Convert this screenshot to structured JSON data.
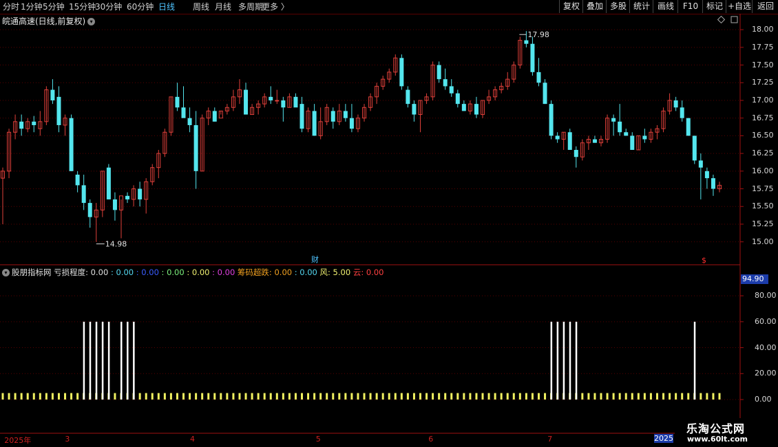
{
  "toolbar": {
    "tabs": [
      "分时",
      "1分钟",
      "5分钟",
      "15分钟",
      "30分钟",
      "60分钟",
      "日线",
      "周线",
      "月线",
      "多周期",
      "更多 〉"
    ],
    "active_tab": "日线",
    "right_buttons": [
      "复权",
      "叠加",
      "多股",
      "统计",
      "画线",
      "F10",
      "标记",
      "+自选",
      "返回"
    ]
  },
  "chart_title": "皖通高速(日线,前复权)",
  "chart_title_icon": "chevron-down-icon",
  "price_axis": {
    "ticks": [
      "18.00",
      "17.75",
      "17.50",
      "17.25",
      "17.00",
      "16.75",
      "16.50",
      "16.25",
      "16.00",
      "15.75",
      "15.50",
      "15.25",
      "15.00"
    ]
  },
  "markers": {
    "high": "17.98",
    "low": "14.98",
    "finance": "财",
    "dividend": "$"
  },
  "indicator": {
    "name": "股朋指标网",
    "items": [
      {
        "label": "亏损程度: 0.00",
        "color": "#e0e0e0"
      },
      {
        "label": ": 0.00",
        "color": "#54d7f0"
      },
      {
        "label": ": 0.00",
        "color": "#3a5cff"
      },
      {
        "label": ": 0.00",
        "color": "#7cf07c"
      },
      {
        "label": ": 0.00",
        "color": "#f0f070"
      },
      {
        "label": ": 0.00",
        "color": "#e040e0"
      },
      {
        "label": "筹码超跌: 0.00",
        "color": "#f0a020"
      },
      {
        "label": ": 0.00",
        "color": "#54d7f0"
      },
      {
        "label": "风: 5.00",
        "color": "#f0f070"
      },
      {
        "label": "云: 0.00",
        "color": "#ff4040"
      }
    ],
    "badge": "94.90",
    "ticks": [
      "80.00",
      "60.00",
      "40.00",
      "20.00",
      "0.00"
    ]
  },
  "x_axis": {
    "labels": [
      {
        "text": "2025年",
        "pos": 0.003
      },
      {
        "text": "3",
        "pos": 0.085
      },
      {
        "text": "4",
        "pos": 0.254
      },
      {
        "text": "5",
        "pos": 0.424
      },
      {
        "text": "6",
        "pos": 0.576
      },
      {
        "text": "7",
        "pos": 0.737
      }
    ],
    "year_badge": "2025"
  },
  "watermark": {
    "line1": "乐淘公式网",
    "line2": "www.60lt.com"
  },
  "colors": {
    "up": "#e0403a",
    "down": "#54e6ee",
    "grid": "#5a0000",
    "axis": "#a01010"
  },
  "chart_data": {
    "type": "candlestick",
    "ylim": [
      14.88,
      18.05
    ],
    "candles": [
      [
        15.9,
        16.05,
        15.25,
        16.0
      ],
      [
        16.0,
        16.6,
        15.9,
        16.55
      ],
      [
        16.55,
        16.8,
        16.45,
        16.7
      ],
      [
        16.7,
        16.8,
        16.5,
        16.6
      ],
      [
        16.6,
        16.75,
        16.55,
        16.7
      ],
      [
        16.7,
        16.78,
        16.55,
        16.65
      ],
      [
        16.6,
        16.85,
        16.5,
        16.7
      ],
      [
        16.7,
        17.2,
        16.65,
        17.15
      ],
      [
        17.15,
        17.3,
        16.95,
        17.0
      ],
      [
        17.05,
        17.2,
        16.55,
        16.65
      ],
      [
        16.65,
        16.8,
        16.5,
        16.75
      ],
      [
        16.75,
        16.8,
        16.0,
        16.0
      ],
      [
        15.95,
        16.0,
        15.7,
        15.8
      ],
      [
        15.8,
        15.95,
        15.45,
        15.55
      ],
      [
        15.55,
        15.6,
        15.2,
        15.35
      ],
      [
        15.35,
        15.55,
        15.0,
        15.45
      ],
      [
        15.45,
        16.0,
        15.35,
        16.0
      ],
      [
        16.05,
        16.1,
        15.6,
        15.6
      ],
      [
        15.6,
        15.7,
        15.3,
        15.45
      ],
      [
        15.45,
        15.6,
        15.05,
        15.65
      ],
      [
        15.65,
        15.7,
        15.55,
        15.6
      ],
      [
        15.6,
        15.8,
        15.5,
        15.75
      ],
      [
        15.75,
        15.85,
        15.5,
        15.6
      ],
      [
        15.6,
        15.9,
        15.4,
        15.85
      ],
      [
        15.85,
        16.1,
        15.8,
        16.05
      ],
      [
        16.05,
        16.3,
        15.9,
        16.25
      ],
      [
        16.25,
        16.6,
        16.2,
        16.55
      ],
      [
        16.55,
        17.05,
        16.5,
        17.05
      ],
      [
        17.05,
        17.25,
        16.85,
        16.9
      ],
      [
        16.9,
        17.2,
        16.85,
        16.75
      ],
      [
        16.75,
        16.9,
        16.55,
        16.65
      ],
      [
        16.65,
        16.85,
        15.75,
        16.0
      ],
      [
        16.0,
        16.8,
        16.0,
        16.75
      ],
      [
        16.75,
        16.9,
        16.65,
        16.85
      ],
      [
        16.85,
        16.9,
        16.7,
        16.7
      ],
      [
        16.75,
        16.85,
        16.8,
        16.85
      ],
      [
        16.85,
        16.95,
        16.8,
        16.9
      ],
      [
        16.9,
        17.15,
        16.85,
        17.05
      ],
      [
        17.05,
        17.3,
        16.95,
        17.15
      ],
      [
        17.15,
        17.25,
        16.8,
        16.8
      ],
      [
        16.8,
        16.95,
        16.8,
        16.9
      ],
      [
        16.9,
        17.0,
        16.8,
        16.95
      ],
      [
        16.95,
        17.1,
        16.9,
        17.05
      ],
      [
        17.05,
        17.2,
        16.95,
        17.0
      ],
      [
        17.0,
        17.15,
        16.95,
        17.0
      ],
      [
        17.0,
        17.05,
        16.7,
        16.9
      ],
      [
        16.9,
        17.1,
        16.9,
        17.05
      ],
      [
        17.05,
        17.1,
        16.95,
        16.9
      ],
      [
        16.95,
        17.05,
        16.55,
        16.6
      ],
      [
        16.6,
        16.9,
        16.55,
        16.85
      ],
      [
        16.85,
        16.95,
        16.5,
        16.5
      ],
      [
        16.5,
        16.9,
        16.45,
        16.7
      ],
      [
        16.7,
        16.95,
        16.65,
        16.9
      ],
      [
        16.85,
        16.9,
        16.6,
        16.7
      ],
      [
        16.7,
        16.95,
        16.65,
        16.85
      ],
      [
        16.85,
        16.95,
        16.7,
        16.75
      ],
      [
        16.75,
        16.95,
        16.55,
        16.6
      ],
      [
        16.6,
        16.8,
        16.55,
        16.75
      ],
      [
        16.75,
        16.95,
        16.7,
        16.9
      ],
      [
        16.9,
        17.1,
        16.85,
        17.05
      ],
      [
        17.05,
        17.25,
        16.95,
        17.2
      ],
      [
        17.2,
        17.35,
        17.15,
        17.3
      ],
      [
        17.3,
        17.45,
        17.25,
        17.4
      ],
      [
        17.4,
        17.65,
        17.35,
        17.6
      ],
      [
        17.6,
        17.65,
        17.15,
        17.2
      ],
      [
        17.15,
        17.2,
        16.9,
        16.95
      ],
      [
        16.95,
        17.0,
        16.7,
        16.8
      ],
      [
        16.8,
        17.0,
        16.55,
        17.0
      ],
      [
        17.0,
        17.1,
        16.95,
        17.05
      ],
      [
        17.05,
        17.55,
        17.0,
        17.5
      ],
      [
        17.5,
        17.55,
        17.25,
        17.3
      ],
      [
        17.3,
        17.45,
        17.15,
        17.2
      ],
      [
        17.2,
        17.3,
        17.05,
        17.1
      ],
      [
        17.1,
        17.15,
        16.9,
        16.95
      ],
      [
        16.95,
        17.0,
        16.85,
        16.85
      ],
      [
        16.85,
        17.0,
        16.8,
        16.95
      ],
      [
        16.95,
        17.05,
        16.75,
        16.8
      ],
      [
        16.8,
        17.0,
        16.75,
        17.0
      ],
      [
        17.0,
        17.15,
        16.95,
        17.05
      ],
      [
        17.05,
        17.2,
        17.0,
        17.15
      ],
      [
        17.15,
        17.25,
        17.1,
        17.2
      ],
      [
        17.2,
        17.4,
        17.15,
        17.3
      ],
      [
        17.3,
        17.55,
        17.25,
        17.5
      ],
      [
        17.5,
        17.9,
        17.45,
        17.85
      ],
      [
        17.85,
        17.98,
        17.75,
        17.8
      ],
      [
        17.8,
        17.9,
        17.35,
        17.4
      ],
      [
        17.4,
        17.6,
        17.2,
        17.25
      ],
      [
        17.25,
        17.3,
        16.95,
        16.95
      ],
      [
        16.95,
        17.0,
        16.45,
        16.5
      ],
      [
        16.5,
        16.55,
        16.4,
        16.45
      ],
      [
        16.45,
        16.55,
        16.3,
        16.55
      ],
      [
        16.55,
        16.6,
        16.35,
        16.3
      ],
      [
        16.3,
        16.35,
        16.05,
        16.2
      ],
      [
        16.2,
        16.45,
        16.15,
        16.4
      ],
      [
        16.4,
        16.5,
        16.3,
        16.45
      ],
      [
        16.45,
        16.5,
        16.4,
        16.4
      ],
      [
        16.4,
        16.5,
        16.35,
        16.45
      ],
      [
        16.45,
        16.8,
        16.4,
        16.75
      ],
      [
        16.75,
        16.8,
        16.5,
        16.7
      ],
      [
        16.7,
        16.95,
        16.5,
        16.55
      ],
      [
        16.55,
        16.6,
        16.5,
        16.5
      ],
      [
        16.5,
        16.55,
        16.3,
        16.3
      ],
      [
        16.3,
        16.5,
        16.3,
        16.5
      ],
      [
        16.5,
        16.6,
        16.4,
        16.45
      ],
      [
        16.45,
        16.6,
        16.4,
        16.55
      ],
      [
        16.55,
        16.65,
        16.45,
        16.6
      ],
      [
        16.6,
        16.9,
        16.55,
        16.85
      ],
      [
        16.85,
        17.1,
        16.8,
        17.0
      ],
      [
        17.0,
        17.05,
        16.85,
        16.9
      ],
      [
        16.9,
        17.0,
        16.7,
        16.75
      ],
      [
        16.75,
        16.75,
        16.5,
        16.5
      ],
      [
        16.5,
        16.5,
        16.1,
        16.15
      ],
      [
        16.15,
        16.25,
        15.6,
        16.05
      ],
      [
        16.0,
        16.05,
        15.75,
        15.9
      ],
      [
        15.9,
        15.95,
        15.65,
        15.75
      ],
      [
        15.75,
        15.85,
        15.7,
        15.8
      ]
    ],
    "indicator_bars": [
      {
        "index": 13,
        "value": 60
      },
      {
        "index": 14,
        "value": 60
      },
      {
        "index": 15,
        "value": 60
      },
      {
        "index": 16,
        "value": 60
      },
      {
        "index": 17,
        "value": 60
      },
      {
        "index": 19,
        "value": 60
      },
      {
        "index": 20,
        "value": 60
      },
      {
        "index": 21,
        "value": 60
      },
      {
        "index": 88,
        "value": 60
      },
      {
        "index": 89,
        "value": 60
      },
      {
        "index": 90,
        "value": 60
      },
      {
        "index": 91,
        "value": 60
      },
      {
        "index": 92,
        "value": 60
      },
      {
        "index": 111,
        "value": 60
      }
    ],
    "indicator_ylim": [
      0,
      94.9
    ]
  }
}
